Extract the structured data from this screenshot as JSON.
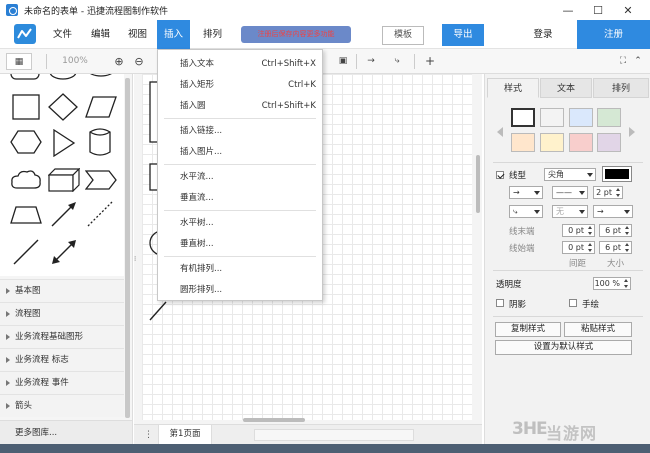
{
  "window": {
    "title": "未命名的表单 - 迅捷流程图制作软件",
    "minimize_glyph": "—",
    "maximize_glyph": "☐",
    "close_glyph": "✕"
  },
  "menubar": {
    "items": [
      "文件",
      "编辑",
      "视图",
      "插入",
      "排列"
    ],
    "active_item": "插入",
    "notice": "注册后保存内容更多功能",
    "template_label": "模板",
    "export_label": "导出",
    "login_label": "登录",
    "register_label": "注册"
  },
  "toolbar": {
    "zoom": "100%",
    "zoom_in_glyph": "⊕",
    "zoom_out_glyph": "⊖",
    "add_glyph": "+"
  },
  "shape_panel": {
    "categories": [
      "基本图",
      "流程图",
      "业务流程基础图形",
      "业务流程 标志",
      "业务流程 事件",
      "箭头"
    ],
    "more_label": "更多图库..."
  },
  "insert_menu": {
    "items": [
      {
        "label": "插入文本",
        "shortcut": "Ctrl+Shift+X"
      },
      {
        "label": "插入矩形",
        "shortcut": "Ctrl+K"
      },
      {
        "label": "插入圆",
        "shortcut": "Ctrl+Shift+K"
      },
      {
        "label": "插入链接...",
        "shortcut": ""
      },
      {
        "label": "插入图片...",
        "shortcut": ""
      },
      {
        "label": "水平流...",
        "shortcut": ""
      },
      {
        "label": "垂直流...",
        "shortcut": ""
      },
      {
        "label": "水平树...",
        "shortcut": ""
      },
      {
        "label": "垂直树...",
        "shortcut": ""
      },
      {
        "label": "有机排列...",
        "shortcut": ""
      },
      {
        "label": "圆形排列...",
        "shortcut": ""
      }
    ]
  },
  "page_bar": {
    "page_tab": "第1页面"
  },
  "properties": {
    "tabs": [
      "样式",
      "文本",
      "排列"
    ],
    "active_tab": "样式",
    "swatches": [
      "#ffffff",
      "#f3f3f3",
      "#dae8fc",
      "#d5e8d4",
      "#ffe6cc",
      "#fff2cc",
      "#f8cecc",
      "#e1d5e7"
    ],
    "line_label": "线型",
    "corner_value": "尖角",
    "line_color": "#000000",
    "line_width": "2 pt",
    "wave_value": "无",
    "line_end_label": "线末端",
    "line_start_label": "线始端",
    "end_spacing": "0 pt",
    "end_size": "6 pt",
    "start_spacing": "0 pt",
    "start_size": "6 pt",
    "spacing_label": "间距",
    "size_label": "大小",
    "opacity_label": "透明度",
    "opacity_value": "100 %",
    "shadow_label": "阴影",
    "sketch_label": "手绘",
    "copy_style": "复制样式",
    "paste_style": "粘贴样式",
    "set_default": "设置为默认样式"
  },
  "watermark": {
    "mark": "3HE",
    "text": "当游网"
  }
}
